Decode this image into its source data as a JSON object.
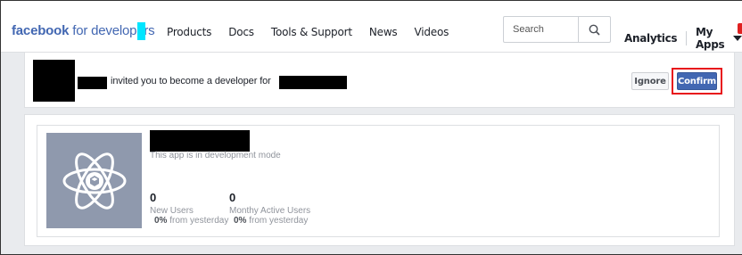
{
  "header": {
    "brand_bold": "facebook",
    "brand_rest": " for developers",
    "nav": [
      "Products",
      "Docs",
      "Tools & Support",
      "News",
      "Videos"
    ],
    "search_placeholder": "Search",
    "analytics": "Analytics",
    "my_apps": "My Apps"
  },
  "invite": {
    "text": "invited you to become a developer for",
    "ignore_label": "Ignore",
    "confirm_label": "Confirm"
  },
  "app": {
    "status": "This app is in development mode",
    "stats": [
      {
        "value": "0",
        "label": "New Users",
        "delta": "0%",
        "delta_suffix": " from yesterday"
      },
      {
        "value": "0",
        "label": "Monthy Active Users",
        "delta": "0%",
        "delta_suffix": " from yesterday"
      }
    ]
  },
  "colors": {
    "brand": "#4267b2",
    "highlight": "#e8141b",
    "icon_bg": "#8f99ad"
  }
}
